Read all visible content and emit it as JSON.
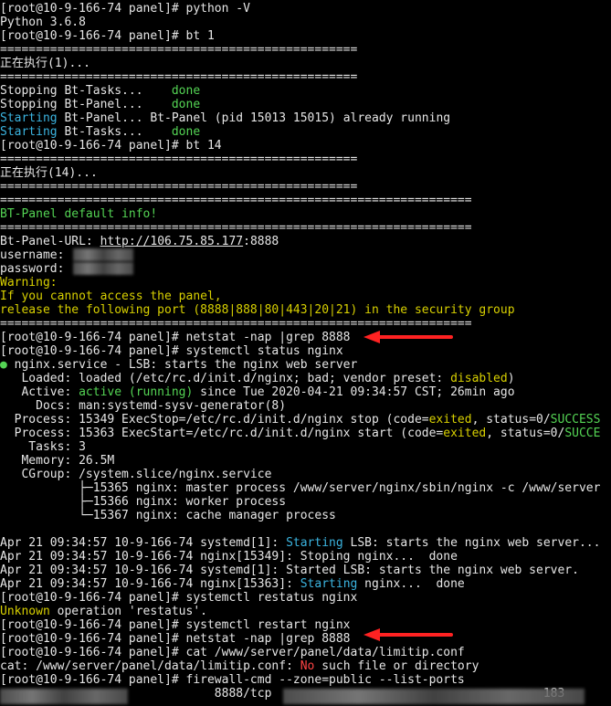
{
  "terminal": {
    "lines": [
      {
        "segments": [
          {
            "text": "[root@10-9-166-74 panel]# python -V",
            "color": "white"
          }
        ]
      },
      {
        "segments": [
          {
            "text": "Python 3.6.8",
            "color": "white"
          }
        ]
      },
      {
        "segments": [
          {
            "text": "[root@10-9-166-74 panel]# bt 1",
            "color": "white"
          }
        ]
      },
      {
        "segments": [
          {
            "text": "==================================================",
            "color": "white"
          }
        ]
      },
      {
        "segments": [
          {
            "text": "正在执行(1)...",
            "color": "white"
          }
        ]
      },
      {
        "segments": [
          {
            "text": "==================================================",
            "color": "white"
          }
        ]
      },
      {
        "segments": [
          {
            "text": "Stopping Bt-Tasks...    ",
            "color": "white"
          },
          {
            "text": "done",
            "color": "green"
          }
        ]
      },
      {
        "segments": [
          {
            "text": "Stopping Bt-Panel...    ",
            "color": "white"
          },
          {
            "text": "done",
            "color": "green"
          }
        ]
      },
      {
        "segments": [
          {
            "text": "Starting",
            "color": "cyan"
          },
          {
            "text": " Bt-Panel... Bt-Panel (pid 15013 15015) already running",
            "color": "white"
          }
        ]
      },
      {
        "segments": [
          {
            "text": "Starting",
            "color": "cyan"
          },
          {
            "text": " Bt-Tasks...    ",
            "color": "white"
          },
          {
            "text": "done",
            "color": "green"
          }
        ]
      },
      {
        "segments": [
          {
            "text": "[root@10-9-166-74 panel]# bt 14",
            "color": "white"
          }
        ]
      },
      {
        "segments": [
          {
            "text": "==================================================",
            "color": "white"
          }
        ]
      },
      {
        "segments": [
          {
            "text": "正在执行(14)...",
            "color": "white"
          }
        ]
      },
      {
        "segments": [
          {
            "text": "==================================================",
            "color": "white"
          }
        ]
      },
      {
        "segments": [
          {
            "text": "==================================================================",
            "color": "white"
          }
        ]
      },
      {
        "segments": [
          {
            "text": "BT-Panel default info!",
            "color": "green"
          }
        ]
      },
      {
        "segments": [
          {
            "text": "==================================================================",
            "color": "white"
          }
        ]
      },
      {
        "segments": [
          {
            "text": "Bt-Panel-URL: ",
            "color": "white"
          },
          {
            "text": "http://106.75.85.177",
            "color": "white",
            "link": true
          },
          {
            "text": ":8888",
            "color": "white"
          }
        ]
      },
      {
        "segments": [
          {
            "text": "username: ",
            "color": "white"
          }
        ]
      },
      {
        "segments": [
          {
            "text": "password: ",
            "color": "white"
          }
        ]
      },
      {
        "segments": [
          {
            "text": "Warning:",
            "color": "yellow"
          }
        ]
      },
      {
        "segments": [
          {
            "text": "If you cannot access the panel,",
            "color": "yellow"
          }
        ]
      },
      {
        "segments": [
          {
            "text": "release the following port (8888|888|80|443|20|21) in the security group",
            "color": "yellow"
          }
        ]
      },
      {
        "segments": [
          {
            "text": "==================================================================",
            "color": "white"
          }
        ]
      },
      {
        "segments": [
          {
            "text": "[root@10-9-166-74 panel]# netstat -nap |grep 8888",
            "color": "white"
          }
        ]
      },
      {
        "segments": [
          {
            "text": "[root@10-9-166-74 panel]# systemctl status nginx",
            "color": "white"
          }
        ]
      },
      {
        "segments": [
          {
            "text": "●",
            "color": "green"
          },
          {
            "text": " nginx.service - LSB: starts the nginx web server",
            "color": "white"
          }
        ]
      },
      {
        "segments": [
          {
            "text": "   Loaded: loaded (/etc/rc.d/init.d/nginx; bad; vendor preset: ",
            "color": "white"
          },
          {
            "text": "disabled",
            "color": "yellow"
          },
          {
            "text": ")",
            "color": "white"
          }
        ]
      },
      {
        "segments": [
          {
            "text": "   Active: ",
            "color": "white"
          },
          {
            "text": "active (running)",
            "color": "green"
          },
          {
            "text": " since Tue 2020-04-21 09:34:57 CST; 26min ago",
            "color": "white"
          }
        ]
      },
      {
        "segments": [
          {
            "text": "     Docs: man:systemd-sysv-generator(8)",
            "color": "white"
          }
        ]
      },
      {
        "segments": [
          {
            "text": "  Process: 15349 ExecStop=/etc/rc.d/init.d/nginx stop (code=",
            "color": "white"
          },
          {
            "text": "exited",
            "color": "yellow"
          },
          {
            "text": ", status=0/",
            "color": "white"
          },
          {
            "text": "SUCCESS",
            "color": "green"
          }
        ]
      },
      {
        "segments": [
          {
            "text": "  Process: 15363 ExecStart=/etc/rc.d/init.d/nginx start (code=",
            "color": "white"
          },
          {
            "text": "exited",
            "color": "yellow"
          },
          {
            "text": ", status=0/",
            "color": "white"
          },
          {
            "text": "SUCCE",
            "color": "green"
          }
        ]
      },
      {
        "segments": [
          {
            "text": "    Tasks: 3",
            "color": "white"
          }
        ]
      },
      {
        "segments": [
          {
            "text": "   Memory: 26.5M",
            "color": "white"
          }
        ]
      },
      {
        "segments": [
          {
            "text": "   CGroup: /system.slice/nginx.service",
            "color": "white"
          }
        ]
      },
      {
        "segments": [
          {
            "text": "           ├─15365 nginx: master process /www/server/nginx/sbin/nginx -c /www/server",
            "color": "white"
          }
        ]
      },
      {
        "segments": [
          {
            "text": "           ├─15366 nginx: worker process",
            "color": "white"
          }
        ]
      },
      {
        "segments": [
          {
            "text": "           └─15367 nginx: cache manager process",
            "color": "white"
          }
        ]
      },
      {
        "segments": [
          {
            "text": "",
            "color": "white"
          }
        ]
      },
      {
        "segments": [
          {
            "text": "Apr 21 09:34:57 10-9-166-74 systemd[1]: ",
            "color": "white"
          },
          {
            "text": "Starting",
            "color": "cyan"
          },
          {
            "text": " LSB: starts the nginx web server...",
            "color": "white"
          }
        ]
      },
      {
        "segments": [
          {
            "text": "Apr 21 09:34:57 10-9-166-74 nginx[15349]: Stoping nginx...  done",
            "color": "white"
          }
        ]
      },
      {
        "segments": [
          {
            "text": "Apr 21 09:34:57 10-9-166-74 systemd[1]: Started LSB: starts the nginx web server.",
            "color": "white"
          }
        ]
      },
      {
        "segments": [
          {
            "text": "Apr 21 09:34:57 10-9-166-74 nginx[15363]: ",
            "color": "white"
          },
          {
            "text": "Starting",
            "color": "cyan"
          },
          {
            "text": " nginx...  done",
            "color": "white"
          }
        ]
      },
      {
        "segments": [
          {
            "text": "[root@10-9-166-74 panel]# systemctl restatus nginx",
            "color": "white"
          }
        ]
      },
      {
        "segments": [
          {
            "text": "Unknown",
            "color": "yellow"
          },
          {
            "text": " operation 'restatus'.",
            "color": "white"
          }
        ]
      },
      {
        "segments": [
          {
            "text": "[root@10-9-166-74 panel]# systemctl restart nginx",
            "color": "white"
          }
        ]
      },
      {
        "segments": [
          {
            "text": "[root@10-9-166-74 panel]# netstat -nap |grep 8888",
            "color": "white"
          }
        ]
      },
      {
        "segments": [
          {
            "text": "[root@10-9-166-74 panel]# cat /www/server/panel/data/limitip.conf",
            "color": "white"
          }
        ]
      },
      {
        "segments": [
          {
            "text": "cat: /www/server/panel/data/limitip.conf: ",
            "color": "white"
          },
          {
            "text": "No",
            "color": "red"
          },
          {
            "text": " such file or directory",
            "color": "white"
          }
        ]
      },
      {
        "segments": [
          {
            "text": "[root@10-9-166-74 panel]# firewall-cmd --zone=public --list-ports",
            "color": "white"
          }
        ]
      },
      {
        "segments": [
          {
            "text": "                              8888/tcp                                      183",
            "color": "white"
          }
        ]
      }
    ]
  },
  "colors": {
    "background": "#000000",
    "white": "#e6e6e6",
    "green": "#54d454",
    "yellow": "#d8d000",
    "cyan": "#3bb4e0",
    "red": "#ff4444",
    "annotation_arrow": "#ff2222"
  }
}
